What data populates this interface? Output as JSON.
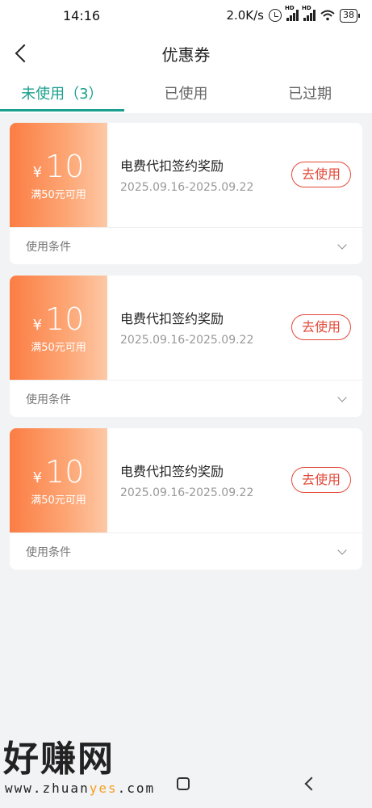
{
  "status_bar": {
    "time": "14:16",
    "speed": "2.0K/s",
    "battery": "38",
    "signal_badge": "HD"
  },
  "header": {
    "title": "优惠券"
  },
  "tabs": [
    {
      "label": "未使用（3）",
      "active": true
    },
    {
      "label": "已使用",
      "active": false
    },
    {
      "label": "已过期",
      "active": false
    }
  ],
  "coupons": [
    {
      "currency": "¥",
      "amount": "10",
      "condition": "满50元可用",
      "name": "电费代扣签约奖励",
      "validity": "2025.09.16-2025.09.22",
      "action": "去使用",
      "terms_label": "使用条件"
    },
    {
      "currency": "¥",
      "amount": "10",
      "condition": "满50元可用",
      "name": "电费代扣签约奖励",
      "validity": "2025.09.16-2025.09.22",
      "action": "去使用",
      "terms_label": "使用条件"
    },
    {
      "currency": "¥",
      "amount": "10",
      "condition": "满50元可用",
      "name": "电费代扣签约奖励",
      "validity": "2025.09.16-2025.09.22",
      "action": "去使用",
      "terms_label": "使用条件"
    }
  ],
  "watermark": {
    "text": "好赚网",
    "url_prefix": "www.zhuan",
    "url_highlight": "yes",
    "url_suffix": ".com"
  },
  "colors": {
    "accent": "#1a9e8e",
    "coupon_gradient_start": "#fb7d44",
    "action_red": "#e34a3a"
  },
  "icons": [
    "back-icon",
    "alarm-icon",
    "signal-icon",
    "wifi-icon",
    "battery-icon",
    "chevron-down-icon",
    "home-nav-icon",
    "back-nav-icon"
  ]
}
